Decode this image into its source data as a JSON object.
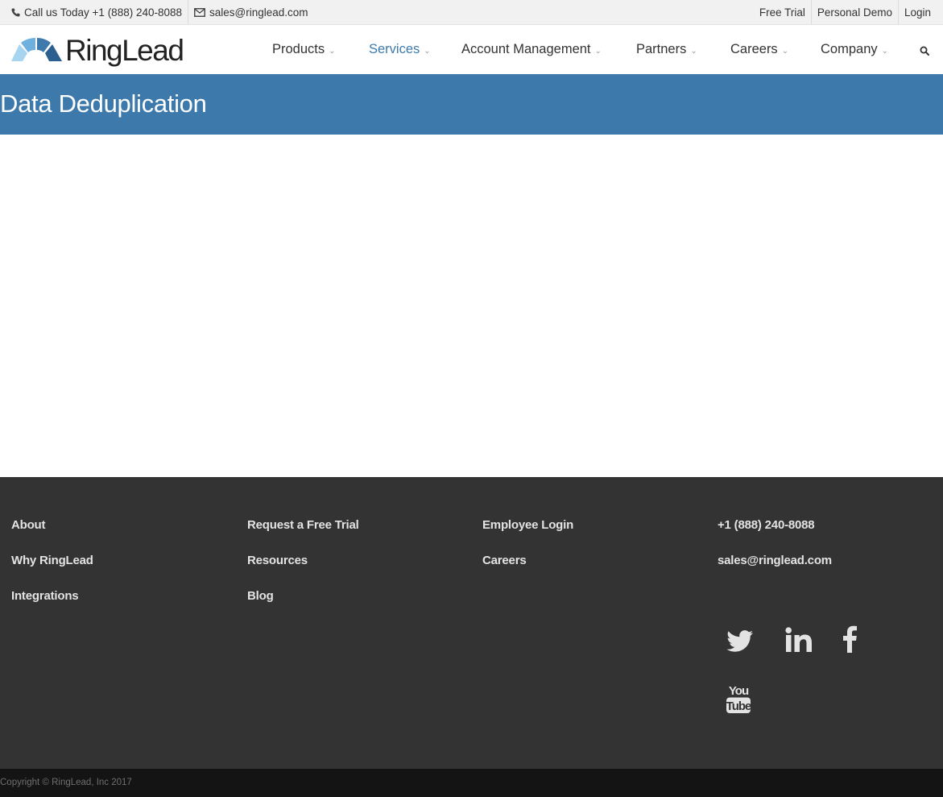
{
  "topbar": {
    "phone_text": "Call us Today +1 (888) 240-8088",
    "email_text": "sales@ringlead.com",
    "links": [
      "Free Trial",
      "Personal Demo",
      "Login"
    ]
  },
  "header": {
    "logo_text": "RingLead",
    "nav": [
      {
        "label": "Products",
        "active": false
      },
      {
        "label": "Services",
        "active": true
      },
      {
        "label": "Account Management",
        "active": false
      },
      {
        "label": "Partners",
        "active": false
      },
      {
        "label": "Careers",
        "active": false
      },
      {
        "label": "Company",
        "active": false
      }
    ]
  },
  "banner": {
    "title": "Data Deduplication"
  },
  "footer": {
    "col1": [
      "About",
      "Why RingLead",
      "Integrations"
    ],
    "col2": [
      "Request a Free Trial",
      "Resources",
      "Blog"
    ],
    "col3": [
      "Employee Login",
      "Careers"
    ],
    "contact": {
      "phone": "+1 (888) 240-8088",
      "email": "sales@ringlead.com"
    },
    "social_icons": [
      "twitter-icon",
      "linkedin-icon",
      "facebook-icon",
      "youtube-icon"
    ],
    "copyright": "Copyright © RingLead, Inc 2017"
  },
  "colors": {
    "brand_blue": "#3d7aab",
    "footer_bg": "#333333",
    "copyright_bg": "#141414",
    "topbar_bg": "#f1f1f1"
  }
}
